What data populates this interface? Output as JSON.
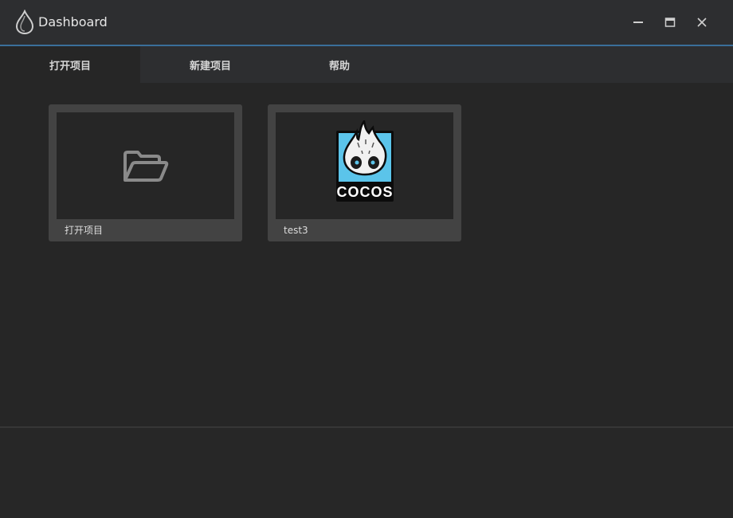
{
  "window": {
    "title": "Dashboard",
    "controls": {
      "minimize": "minimize-icon",
      "maximize": "maximize-icon",
      "close": "close-icon"
    }
  },
  "tabs": [
    {
      "label": "打开项目",
      "active": true
    },
    {
      "label": "新建项目",
      "active": false
    },
    {
      "label": "帮助",
      "active": false
    }
  ],
  "projects": [
    {
      "label": "打开项目",
      "icon": "folder-open-icon"
    },
    {
      "label": "test3",
      "icon": "cocos-logo",
      "logo_text": "COCOS"
    }
  ],
  "colors": {
    "accent": "#3a6f9a",
    "cocos_blue": "#5bc4ea"
  }
}
